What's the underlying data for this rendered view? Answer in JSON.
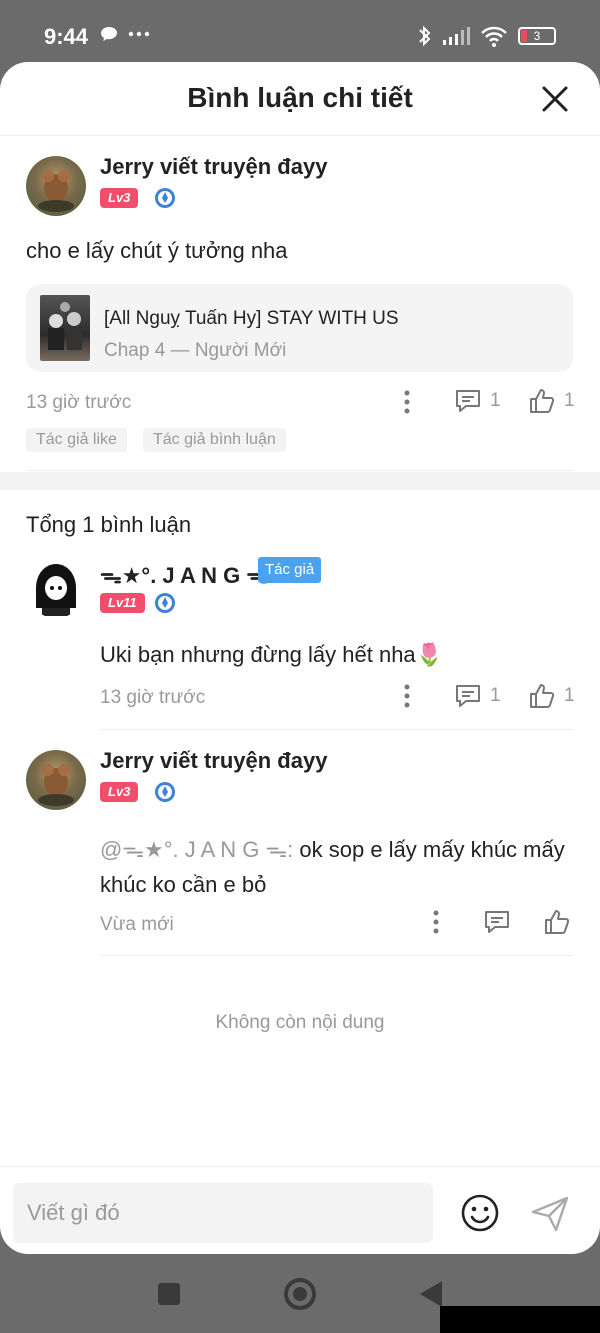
{
  "status_bar": {
    "time": "9:44",
    "battery": "3"
  },
  "header": {
    "title": "Bình luận chi tiết"
  },
  "main_comment": {
    "author": "Jerry viết truyện đayy",
    "level": "Lv3",
    "text": "cho e lấy chút ý tưởng nha",
    "story": {
      "title": "[All Nguỵ Tuấn Hy] STAY WITH US",
      "chapter": "Chap 4 — Người Mới"
    },
    "time": "13 giờ trước",
    "reply_count": "1",
    "like_count": "1",
    "tags": [
      "Tác giả like",
      "Tác giả bình luận"
    ]
  },
  "replies_section": {
    "total_label": "Tổng 1 bình luận"
  },
  "replies": [
    {
      "author": "ᯓ★°. J A N G ᯓ",
      "level": "Lv11",
      "author_tag": "Tác giả",
      "text": "Uki bạn nhưng đừng lấy hết nha🌷",
      "time": "13 giờ trước",
      "reply_count": "1",
      "like_count": "1"
    },
    {
      "author": "Jerry viết truyện đayy",
      "level": "Lv3",
      "mention": "@ᯓ★°. J A N G ᯓ:",
      "text_line1": " ok sop e lấy mấy khúc mấy",
      "text_line2": "khúc ko cần e bỏ",
      "time": "Vừa mới"
    }
  ],
  "footer": {
    "no_more": "Không còn nội dung",
    "input_placeholder": "Viết gì đó"
  },
  "colors": {
    "level_badge": "#f24d6b",
    "author_tag": "#4aa3f0",
    "muted_text": "#999999"
  }
}
